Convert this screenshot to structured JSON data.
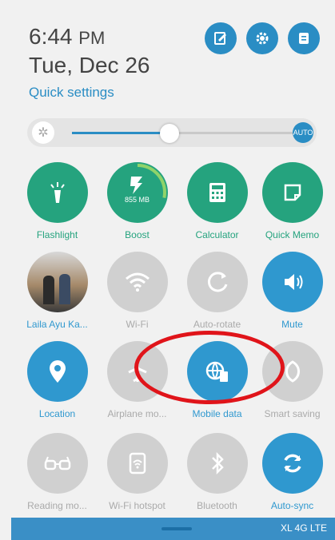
{
  "header": {
    "time": "6:44",
    "ampm": "PM",
    "date": "Tue, Dec 26",
    "quick_settings_label": "Quick settings"
  },
  "brightness": {
    "level": 0.43,
    "auto_label": "AUTO"
  },
  "tiles": {
    "flashlight": "Flashlight",
    "boost": "Boost",
    "boost_value": "855 MB",
    "calculator": "Calculator",
    "quick_memo": "Quick Memo",
    "contact": "Laila Ayu Ka...",
    "wifi": "Wi-Fi",
    "auto_rotate": "Auto-rotate",
    "mute": "Mute",
    "location": "Location",
    "airplane": "Airplane mo...",
    "mobile_data": "Mobile data",
    "smart_saving": "Smart saving",
    "reading_mode": "Reading mo...",
    "wifi_hotspot": "Wi-Fi hotspot",
    "bluetooth": "Bluetooth",
    "auto_sync": "Auto-sync"
  },
  "footer": {
    "carrier": "XL 4G LTE"
  },
  "colors": {
    "accent": "#2a8dc4",
    "green": "#25a37e",
    "annotation": "#e0141a"
  }
}
